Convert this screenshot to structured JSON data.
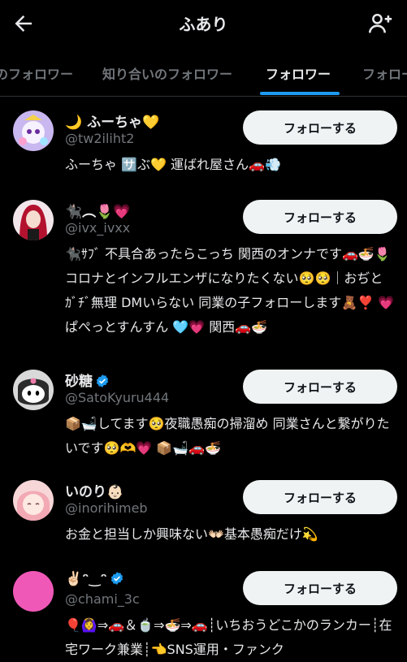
{
  "header": {
    "title": "ふあり"
  },
  "tabs": [
    {
      "label": "のフォロワー"
    },
    {
      "label": "知り合いのフォロワー"
    },
    {
      "label": "フォロワー"
    },
    {
      "label": "フォロー"
    }
  ],
  "follow_label": "フォローする",
  "users": [
    {
      "name": "🌙 ふーちゃ💛",
      "handle": "@tw2iliht2",
      "bio": "ふーちゃ 🈂️ぶ💛 運ばれ屋さん🚗💨",
      "verified": false
    },
    {
      "name": "🐈‍⬛︵🌷💗",
      "handle": "@ivx_ivxx",
      "bio": "🐈‍⬛ｻﾌﾞ 不具合あったらこっち 関西のオンナです🚗🍜🌷 コロナとインフルエンザになりたくない🥺🥺｜おぢと ｶﾞﾁﾞ無理 DMいらない 同業の子フォローします🧸❣️ 💗ぱぺっとすんすん 🩵💗 関西🚗🍜",
      "verified": false
    },
    {
      "name": "砂糖",
      "handle": "@SatoKyuru444",
      "bio": "📦🛁してます🥺夜職愚痴の掃溜め 同業さんと繋がりたいです🥺🫶💗 📦🛁🚗🍜",
      "verified": true
    },
    {
      "name": "いのり👶🏻",
      "handle": "@inorihimeb",
      "bio": "お金と担当しか興味ない👐🏻基本愚痴だけ💫",
      "verified": false
    },
    {
      "name": "✌🏻ᵔ‿ᵔ",
      "handle": "@chami_3c",
      "bio": "🎈🙆‍♀️⇒🚗＆🍵⇒🍜⇒🚗┊いちおうどこかのランカー┊在宅ワーク兼業┊👈SNS運用・ファンク",
      "verified": true
    }
  ],
  "colors": {
    "background": "#000000",
    "accent": "#1d9bf0",
    "button_bg": "#eff3f4",
    "secondary_text": "#71767b"
  }
}
